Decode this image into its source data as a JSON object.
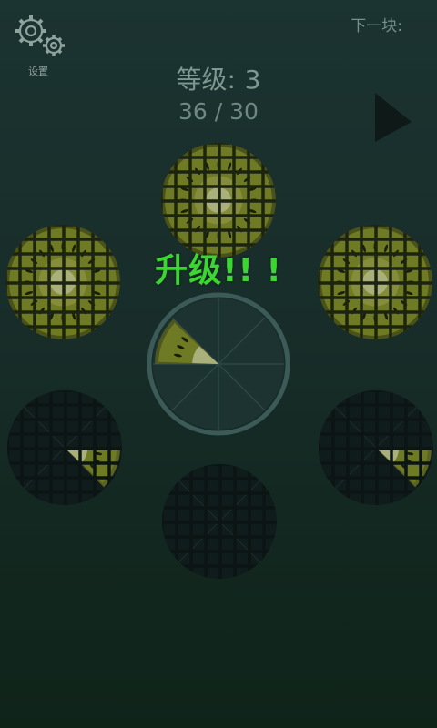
{
  "settings": {
    "label": "设置",
    "icon": "gear-icon"
  },
  "next_piece": {
    "label": "下一块:",
    "slices": 1
  },
  "level": {
    "label": "等级:",
    "value": "3"
  },
  "progress": {
    "text": "36 / 30"
  },
  "banner": {
    "text": "升级!! !"
  },
  "board": {
    "center_plate": {
      "filled_slices": 1
    },
    "plates": [
      {
        "position": "top",
        "state": "full",
        "slices": 8
      },
      {
        "position": "upper-left",
        "state": "full",
        "slices": 8
      },
      {
        "position": "upper-right",
        "state": "full",
        "slices": 8
      },
      {
        "position": "lower-left",
        "state": "partial",
        "slices": 1
      },
      {
        "position": "lower-right",
        "state": "partial",
        "slices": 1
      },
      {
        "position": "bottom",
        "state": "empty",
        "slices": 0
      }
    ]
  },
  "colors": {
    "kiwi_flesh": "#6f7a25",
    "kiwi_core": "#a9b07c",
    "plate_dark": "#101c1c",
    "banner": "#3bd631",
    "center_ring": "#3b5a58"
  }
}
